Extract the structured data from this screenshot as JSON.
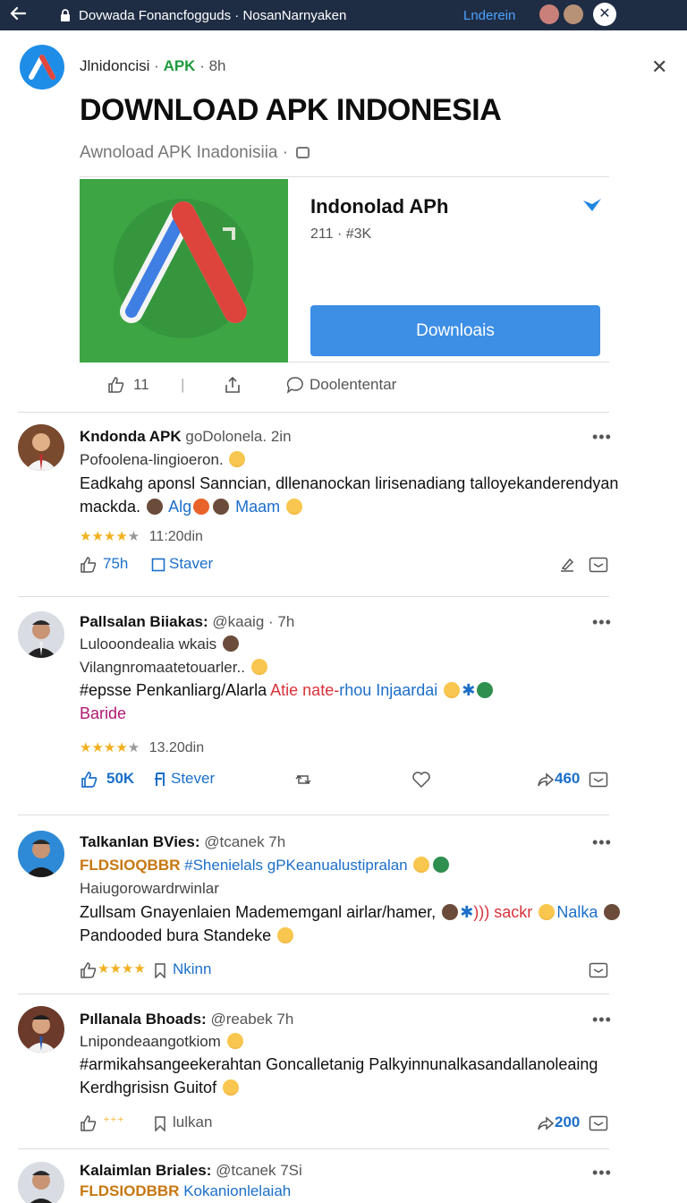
{
  "topbar": {
    "url": "Dovwada Fonancfogguds · NosanNarnyaken",
    "link": "Lnderein"
  },
  "header": {
    "source": "Jlnidoncisi",
    "tag": "APK",
    "age": "8h",
    "title": "DOWNLOAD APK INDONESIA",
    "subtitle": "Awnoload APK Inadonisiia ·"
  },
  "card": {
    "name": "Indonolad APh",
    "stats": "211 · #3K",
    "button": "Downloais"
  },
  "card_actions": {
    "likes": "11",
    "comment": "Doolententar"
  },
  "posts": [
    {
      "name": "Kndonda APK",
      "handle": "goDolonela. 2in",
      "line1": "Pofoolena-lingioeron.",
      "body1": "Eadkahg aponsl Sanncian, dllenanockan lirisenadiang talloyekanderendyan",
      "body2_a": "mackda.",
      "body2_b": "Alg",
      "body2_c": "Maam",
      "rating": "11:20din",
      "stat": "75h",
      "action": "Staver"
    },
    {
      "name": "Pallsalan Biiakas:",
      "handle": "@kaaig · 7h",
      "line1": "Lulooondealia wkais",
      "line2": "Vilangnromaatetouarler..",
      "body1_a": "#epsse Penkanliarg/Alarla",
      "body1_b": "Atie nate-",
      "body1_c": "rhou Injaardai",
      "body2": "Baride",
      "rating": "13.20din",
      "stat": "50K",
      "action": "Stever",
      "share": "460"
    },
    {
      "name": "Talkanlan BVies:",
      "handle": "@tcanek 7h",
      "line1_tag": "FLDSIOQBBR",
      "line1_rest": "#Shenielals gPKeanualustipralan",
      "line2": "Haiugorowardrwinlar",
      "body1_a": "Zullsam Gnayenlaien Madememganl airlar/hamer,",
      "body1_b": "sackr",
      "body1_c": "Nalka",
      "body2": "Pandooded bura Standeke",
      "action": "Nkinn"
    },
    {
      "name": "Pıllanala Bhoads:",
      "handle": "@reabek 7h",
      "line1": "Lnipondeaangotkiom",
      "body1": "#armikahsangeekerahtan Goncalletanig Palkyinnunalkasandallanoleaing",
      "body2": "Kerdhgrisisn Guitof",
      "action": "lulkan",
      "share": "200"
    },
    {
      "name": "Kalaimlan Briales:",
      "handle": "@tcanek 7Si",
      "line1_tag": "FLDSIODBBR",
      "line1_rest": "Kokanionlelaiah"
    }
  ],
  "colors": {
    "topbar": "#1f2d44",
    "accent": "#3d8ee5",
    "apk_green": "#1e9a3f",
    "card_bg": "#3da543"
  }
}
